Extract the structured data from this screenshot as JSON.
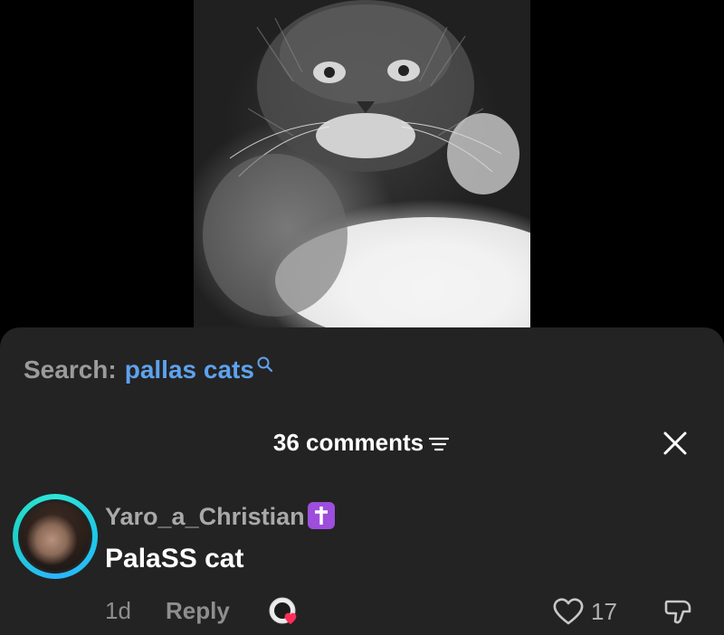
{
  "video": {
    "subject": "pallas cat photo"
  },
  "search": {
    "label": "Search:",
    "term": "pallas cats"
  },
  "comments": {
    "title": "36 comments"
  },
  "comment": {
    "username": "Yaro_a_Christian",
    "text": "PalaSS cat",
    "time": "1d",
    "reply_label": "Reply",
    "like_count": "17"
  },
  "colors": {
    "search_term": "#5ea2ee",
    "sheet_background": "#232323",
    "avatar_ring": "#2ee6d6",
    "cross_badge": "#9d4edd"
  },
  "icons": [
    "search-icon",
    "filter-icon",
    "close-icon",
    "cross-badge-icon",
    "creator-like-icon",
    "heart-icon",
    "dislike-icon"
  ]
}
